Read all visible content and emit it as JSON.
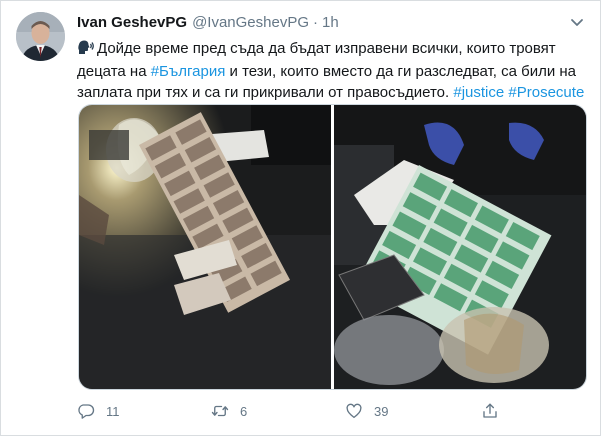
{
  "tweet": {
    "author_name": "Ivan GeshevPG",
    "handle": "@IvanGeshevPG",
    "separator": "·",
    "time": "1h",
    "text_before": "Дойде време пред съда да бъдат изправени всички, които тровят децата на ",
    "link_bulgaria": "#България",
    "text_middle": " и тези, които вместо да ги разследват, са били на заплата при тях и са ги прикривали от правосъдието. ",
    "hashtag_justice": "#justice",
    "space": " ",
    "hashtag_prosecute": "#Prosecute"
  },
  "actions": {
    "reply_count": "11",
    "retweet_count": "6",
    "like_count": "39"
  },
  "icons": {
    "speaking": "speaking-head-icon",
    "menu": "chevron-down-icon",
    "reply": "reply-icon",
    "retweet": "retweet-icon",
    "like": "heart-icon",
    "share": "share-icon"
  },
  "colors": {
    "link": "#1b95e0",
    "muted": "#657786",
    "text": "#14171a"
  }
}
